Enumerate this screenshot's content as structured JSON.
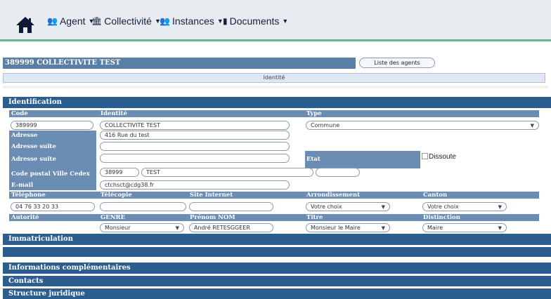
{
  "nav": {
    "items": [
      {
        "icon": "people-icon",
        "label": "Agent"
      },
      {
        "icon": "building-icon",
        "label": "Collectivité"
      },
      {
        "icon": "group-icon",
        "label": "Instances"
      },
      {
        "icon": "document-icon",
        "label": "Documents"
      }
    ]
  },
  "header": {
    "title": "389999  COLLECTIVITE TEST",
    "list_button": "Liste des agents",
    "tab": "Identité"
  },
  "identification": {
    "title": "Identification",
    "labels": {
      "code": "Code",
      "identite": "Identité",
      "type": "Type",
      "adresse": "Adresse",
      "adresse_suite": "Adresse suite",
      "adresse_suite2": "Adresse suite",
      "etat": "Etat",
      "dissoute": "Dissoute",
      "cp_ville": "Code postal Ville Cedex",
      "email": "E-mail",
      "telephone": "Téléphone",
      "telecopie": "Télécopie",
      "site": "Site Internet",
      "arrondissement": "Arrondissement",
      "canton": "Canton",
      "autorite": "Autorité",
      "genre": "GENRE",
      "prenom_nom": "Prénom NOM",
      "titre": "Titre",
      "distinction": "Distinction"
    },
    "values": {
      "code": "389999",
      "identite": "COLLECTIVITE TEST",
      "type": "Commune",
      "adresse": "416 Rue du test",
      "adresse_suite": "",
      "adresse_suite2": "",
      "code_postal": "38999",
      "ville": "TEST",
      "cedex": "",
      "email": "ctchsct@cdg38.fr",
      "telephone": "04 76 33 20 33",
      "telecopie": "",
      "site": "",
      "arrondissement": "Votre choix",
      "canton": "Votre choix",
      "genre": "Monsieur",
      "prenom_nom": "André RETESGGEER",
      "titre": "Monsieur le Maire",
      "distinction": "Maire"
    }
  },
  "sections": [
    "Immatriculation",
    "",
    "Informations complémentaires",
    "Contacts",
    "Structure juridique"
  ]
}
